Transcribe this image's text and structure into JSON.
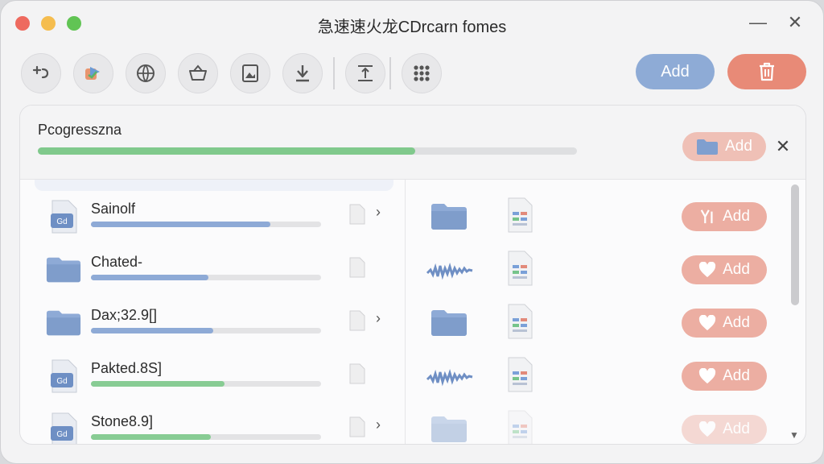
{
  "window": {
    "title": "急速速火龙CDrcarn fomes",
    "minimize_symbol": "—",
    "close_symbol": "✕"
  },
  "toolbar": {
    "icons": [
      "add-link-icon",
      "import-icon",
      "globe-icon",
      "basket-icon",
      "image-icon",
      "download-icon",
      "text-cursor-icon",
      "grid-icon"
    ],
    "add_label": "Add",
    "delete_icon": "trash-icon"
  },
  "progress": {
    "label": "Pcogresszna",
    "percent": 70,
    "add_label": "Add",
    "close_symbol": "✕"
  },
  "left_rows": [
    {
      "name": "Sainolf",
      "progress": 78,
      "color": "#8eaad6",
      "has_chevron": true,
      "icon": "archive-icon"
    },
    {
      "name": "Chated-",
      "progress": 51,
      "color": "#8eaad6",
      "has_chevron": false,
      "icon": "folder-icon"
    },
    {
      "name": "Dax;32.9[]",
      "progress": 53,
      "color": "#8eaad6",
      "has_chevron": true,
      "icon": "folder-icon"
    },
    {
      "name": "Pakted.8S]",
      "progress": 58,
      "color": "#88cc94",
      "has_chevron": false,
      "icon": "archive-icon"
    },
    {
      "name": "Stone8.9]",
      "progress": 52,
      "color": "#88cc94",
      "has_chevron": true,
      "icon": "archive-icon"
    }
  ],
  "right_rows": [
    {
      "icon": "folder-icon",
      "add_label": "Add",
      "action_icon": "fork-icon"
    },
    {
      "icon": "waveform-icon",
      "add_label": "Add",
      "action_icon": "heart-icon"
    },
    {
      "icon": "folder-icon",
      "add_label": "Add",
      "action_icon": "heart-icon"
    },
    {
      "icon": "waveform-icon",
      "add_label": "Add",
      "action_icon": "heart-icon"
    },
    {
      "icon": "folder-icon",
      "add_label": "Add",
      "action_icon": "heart-icon"
    }
  ],
  "scrollbar": {
    "down_arrow": "▼"
  },
  "colors": {
    "accent_blue": "#8eabd6",
    "accent_red": "#e88a77",
    "progress_green": "#80c98c"
  }
}
